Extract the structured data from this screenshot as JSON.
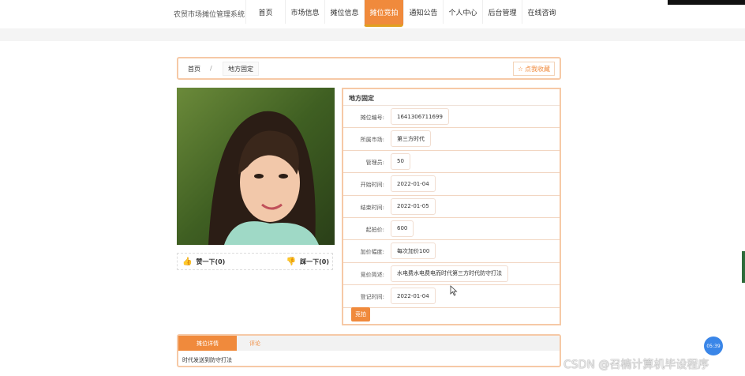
{
  "app": {
    "title": "农贸市场摊位管理系统"
  },
  "nav": {
    "items": [
      {
        "label": "首页"
      },
      {
        "label": "市场信息"
      },
      {
        "label": "摊位信息"
      },
      {
        "label": "摊位竞拍",
        "active": true
      },
      {
        "label": "通知公告"
      },
      {
        "label": "个人中心"
      },
      {
        "label": "后台管理"
      },
      {
        "label": "在线咨询"
      }
    ]
  },
  "breadcrumb": {
    "home": "首页",
    "separator": "/",
    "current": "地方固定"
  },
  "favorite_label": "点我收藏",
  "votes": {
    "up_label": "赞一下(0)",
    "down_label": "踩一下(0)"
  },
  "details": {
    "title": "地方固定",
    "fields": [
      {
        "label": "摊位编号:",
        "value": "1641306711699"
      },
      {
        "label": "所属市场:",
        "value": "第三方时代"
      },
      {
        "label": "管理员:",
        "value": "50"
      },
      {
        "label": "开始时间:",
        "value": "2022-01-04"
      },
      {
        "label": "结束时间:",
        "value": "2022-01-05"
      },
      {
        "label": "起拍价:",
        "value": "600"
      },
      {
        "label": "加价幅度:",
        "value": "每次加价100"
      },
      {
        "label": "竞价简述:",
        "value": "水电费水电费电而时代第三方时代防守打法"
      },
      {
        "label": "登记时间:",
        "value": "2022-01-04"
      }
    ],
    "bid_button": "竞拍"
  },
  "tabs": {
    "items": [
      {
        "label": "摊位详情"
      },
      {
        "label": "评论"
      }
    ],
    "content": "时代发送到防守打法"
  },
  "clock": "05:39",
  "watermark": "CSDN @召楠计算机毕设程序",
  "colors": {
    "accent": "#f08a3c",
    "border": "#f6c9a6"
  }
}
